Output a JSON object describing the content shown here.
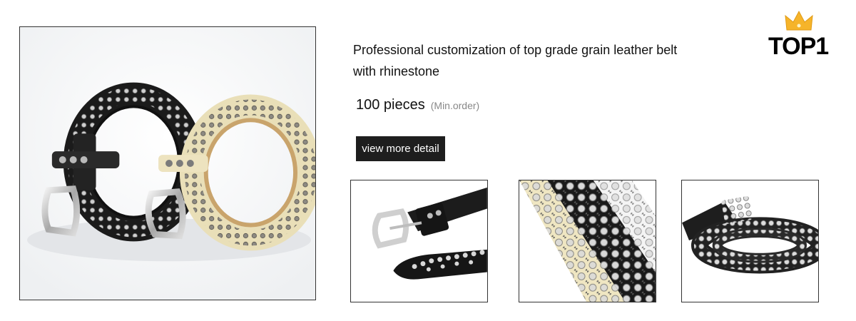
{
  "product": {
    "title": "Professional customization of top grade grain leather belt with rhinestone",
    "quantity": "100 pieces",
    "quantity_label": "(Min.order)",
    "detail_button_label": "view more detail"
  },
  "badge": {
    "text": "TOP1",
    "icon": "crown-icon",
    "crown_color": "#f6b42a"
  },
  "images": {
    "main": "product-photo-belts",
    "thumbnails": [
      "thumb-buckle",
      "thumb-studs-closeup",
      "thumb-rolled-belt"
    ]
  },
  "colors": {
    "button_bg": "#1e1e1e",
    "button_text": "#ffffff",
    "muted_text": "#888888"
  }
}
